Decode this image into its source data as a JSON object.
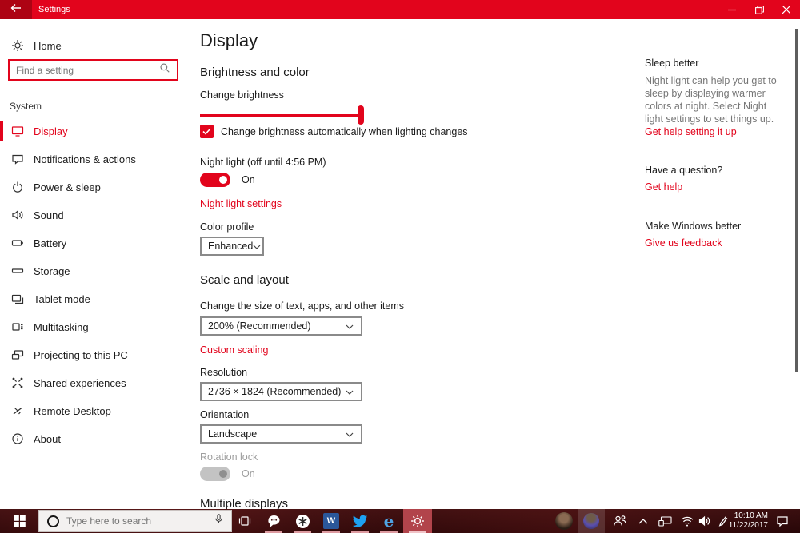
{
  "colors": {
    "accent_red": "#e2041c",
    "titlebar_red": "#e2041c",
    "back_button_red": "#ad0313",
    "taskbar_maroon": "#2e0a0b",
    "link_red": "#e2041c",
    "word_blue": "#2b579a",
    "twitter_blue": "#1da1f2"
  },
  "titlebar": {
    "title": "Settings"
  },
  "sidebar": {
    "home_label": "Home",
    "search_placeholder": "Find a setting",
    "section_label": "System",
    "items": [
      {
        "label": "Display",
        "icon": "display-icon",
        "selected": true
      },
      {
        "label": "Notifications & actions",
        "icon": "notifications-icon"
      },
      {
        "label": "Power & sleep",
        "icon": "power-icon"
      },
      {
        "label": "Sound",
        "icon": "sound-icon"
      },
      {
        "label": "Battery",
        "icon": "battery-icon"
      },
      {
        "label": "Storage",
        "icon": "storage-icon"
      },
      {
        "label": "Tablet mode",
        "icon": "tablet-mode-icon"
      },
      {
        "label": "Multitasking",
        "icon": "multitasking-icon"
      },
      {
        "label": "Projecting to this PC",
        "icon": "projecting-icon"
      },
      {
        "label": "Shared experiences",
        "icon": "shared-experiences-icon"
      },
      {
        "label": "Remote Desktop",
        "icon": "remote-desktop-icon"
      },
      {
        "label": "About",
        "icon": "about-icon"
      }
    ]
  },
  "main": {
    "page_title": "Display",
    "brightness": {
      "heading": "Brightness and color",
      "slider_label": "Change brightness",
      "slider_value_percent": 98,
      "auto_checkbox_label": "Change brightness automatically when lighting changes",
      "auto_checkbox_checked": true
    },
    "night_light": {
      "label": "Night light (off until 4:56 PM)",
      "toggle_state": "On",
      "settings_link": "Night light settings"
    },
    "color_profile": {
      "label": "Color profile",
      "selected_value": "Enhanced"
    },
    "scale": {
      "heading": "Scale and layout",
      "size_label": "Change the size of text, apps, and other items",
      "size_selected_value": "200% (Recommended)",
      "custom_scaling_link": "Custom scaling",
      "resolution_label": "Resolution",
      "resolution_selected_value": "2736 × 1824 (Recommended)",
      "orientation_label": "Orientation",
      "orientation_selected_value": "Landscape",
      "rotation_lock_label": "Rotation lock",
      "rotation_lock_state": "On",
      "rotation_lock_enabled": false
    },
    "multiple_displays_heading": "Multiple displays"
  },
  "right_rail": {
    "sleep_better": {
      "heading": "Sleep better",
      "body": "Night light can help you get to sleep by displaying warmer colors at night. Select Night light settings to set things up.",
      "link": "Get help setting it up"
    },
    "question": {
      "heading": "Have a question?",
      "link": "Get help"
    },
    "feedback": {
      "heading": "Make Windows better",
      "link": "Give us feedback"
    }
  },
  "taskbar": {
    "search_placeholder": "Type here to search",
    "clock": {
      "time": "10:10 AM",
      "date": "11/22/2017"
    },
    "word_glyph": "W",
    "edge_glyph": "e",
    "icons": [
      "windows-start-icon",
      "cortana-icon",
      "microphone-icon",
      "task-view-icon",
      "messaging-app-icon",
      "asterisk-circle-app-icon",
      "word-app-icon",
      "twitter-app-icon",
      "edge-app-icon",
      "settings-app-icon",
      "avatar",
      "avatar",
      "people-icon",
      "chevron-up-icon",
      "device-icon",
      "wifi-icon",
      "volume-icon",
      "pen-icon",
      "action-center-icon"
    ]
  }
}
